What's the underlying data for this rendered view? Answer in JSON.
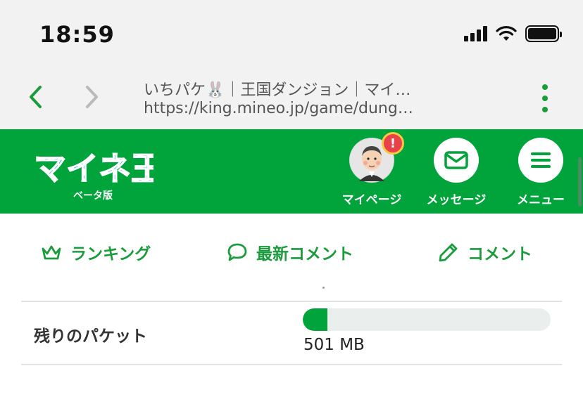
{
  "status_bar": {
    "time": "18:59",
    "icons": [
      "cellular-signal-icon",
      "wifi-icon",
      "battery-icon"
    ]
  },
  "browser": {
    "page_title": "いちパケ🐰｜王国ダンジョン｜マイ…",
    "url": "https://king.mineo.jp/game/dung…",
    "back_icon": "chevron-left-icon",
    "forward_icon": "chevron-right-icon",
    "menu_icon": "more-vertical-icon"
  },
  "header": {
    "logo_text": "マイネ王",
    "logo_subtitle": "ベータ版",
    "my_page_label": "マイページ",
    "message_label": "メッセージ",
    "menu_label": "メニュー",
    "alert_badge": "!",
    "colors": {
      "brand": "#00a43a",
      "alert": "#e8414a",
      "badge_ring": "#f7c843"
    }
  },
  "sub_nav": {
    "ranking_label": "ランキング",
    "latest_comments_label": "最新コメント",
    "comment_label": "コメント",
    "icons": [
      "crown-icon",
      "speech-bubble-icon",
      "pencil-icon"
    ]
  },
  "packet": {
    "label": "残りのパケット",
    "value": "501 MB",
    "fill_fraction": 0.1
  }
}
